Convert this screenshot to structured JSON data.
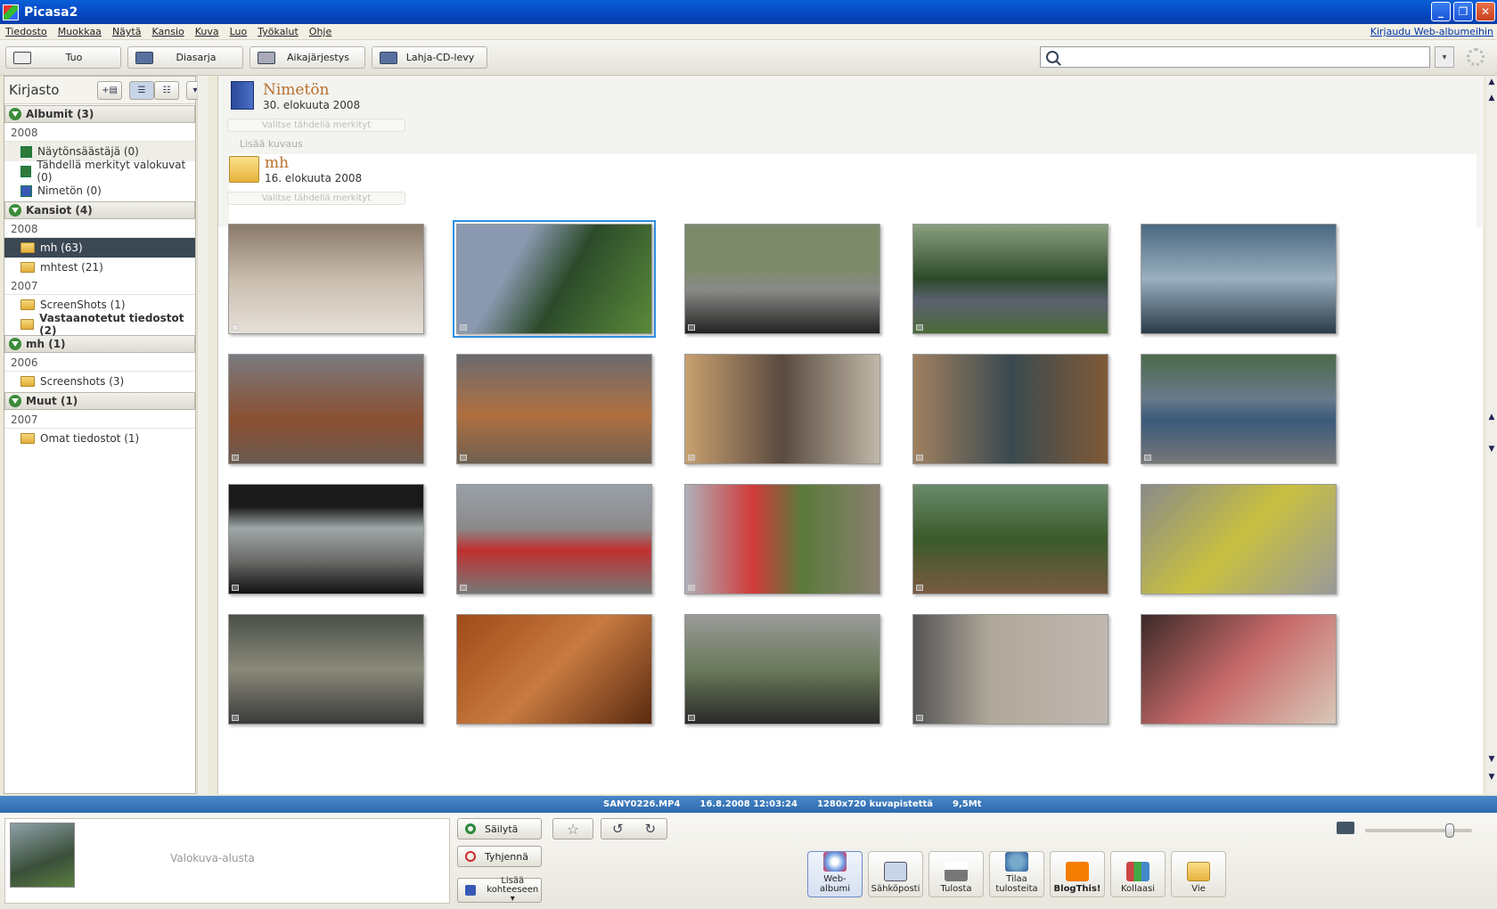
{
  "window": {
    "title": "Picasa2"
  },
  "menu": {
    "items": [
      "Tiedosto",
      "Muokkaa",
      "Näytä",
      "Kansio",
      "Kuva",
      "Luo",
      "Työkalut",
      "Ohje"
    ],
    "login": "Kirjaudu Web-albumeihin"
  },
  "toolbar": {
    "import": "Tuo",
    "slideshow": "Diasarja",
    "timeline": "Aikajärjestys",
    "giftcd": "Lahja-CD-levy"
  },
  "search": {
    "value": ""
  },
  "sidebar": {
    "title": "Kirjasto",
    "albums": {
      "label": "Albumit (3)",
      "year": "2008",
      "items": [
        "Näytönsäästäjä (0)",
        "Tähdellä merkityt valokuvat (0)",
        "Nimetön (0)"
      ]
    },
    "folders": {
      "label": "Kansiot (4)",
      "year1": "2008",
      "items1": [
        "mh (63)",
        "mhtest (21)"
      ],
      "year2": "2007",
      "items2": [
        "ScreenShots (1)",
        "Vastaanotetut tiedostot (2)"
      ]
    },
    "mh": {
      "label": "mh (1)",
      "year": "2006",
      "items": [
        "Screenshots (3)"
      ]
    },
    "other": {
      "label": "Muut (1)",
      "year": "2007",
      "items": [
        "Omat tiedostot (1)"
      ]
    }
  },
  "main": {
    "album1": {
      "name": "Nimetön",
      "date": "30. elokuuta 2008",
      "star_select": "Valitse tähdellä merkityt",
      "add_caption": "Lisää kuvaus"
    },
    "album2": {
      "name": "mh",
      "date": "16. elokuuta 2008",
      "star_select": "Valitse tähdellä merkityt"
    }
  },
  "status": {
    "file": "SANY0226.MP4",
    "date": "16.8.2008 12:03:24",
    "resolution": "1280x720 kuvapistettä",
    "size": "9,5Mt"
  },
  "tray": {
    "label": "Valokuva-alusta",
    "keep": "Säilytä",
    "clear": "Tyhjennä",
    "add_to_1": "Lisää",
    "add_to_2": "kohteeseen",
    "buttons": [
      {
        "l1": "Web-",
        "l2": "albumi"
      },
      {
        "l1": "Sähköposti",
        "l2": ""
      },
      {
        "l1": "Tulosta",
        "l2": ""
      },
      {
        "l1": "Tilaa",
        "l2": "tulosteita"
      },
      {
        "l1": "BlogThis!",
        "l2": ""
      },
      {
        "l1": "Kollaasi",
        "l2": ""
      },
      {
        "l1": "Vie",
        "l2": ""
      }
    ]
  },
  "colors": {
    "accent": "#2d8fe0",
    "album_title": "#b8702c",
    "status_bar": "#3b7abe",
    "selected_folder": "#3c4754"
  }
}
